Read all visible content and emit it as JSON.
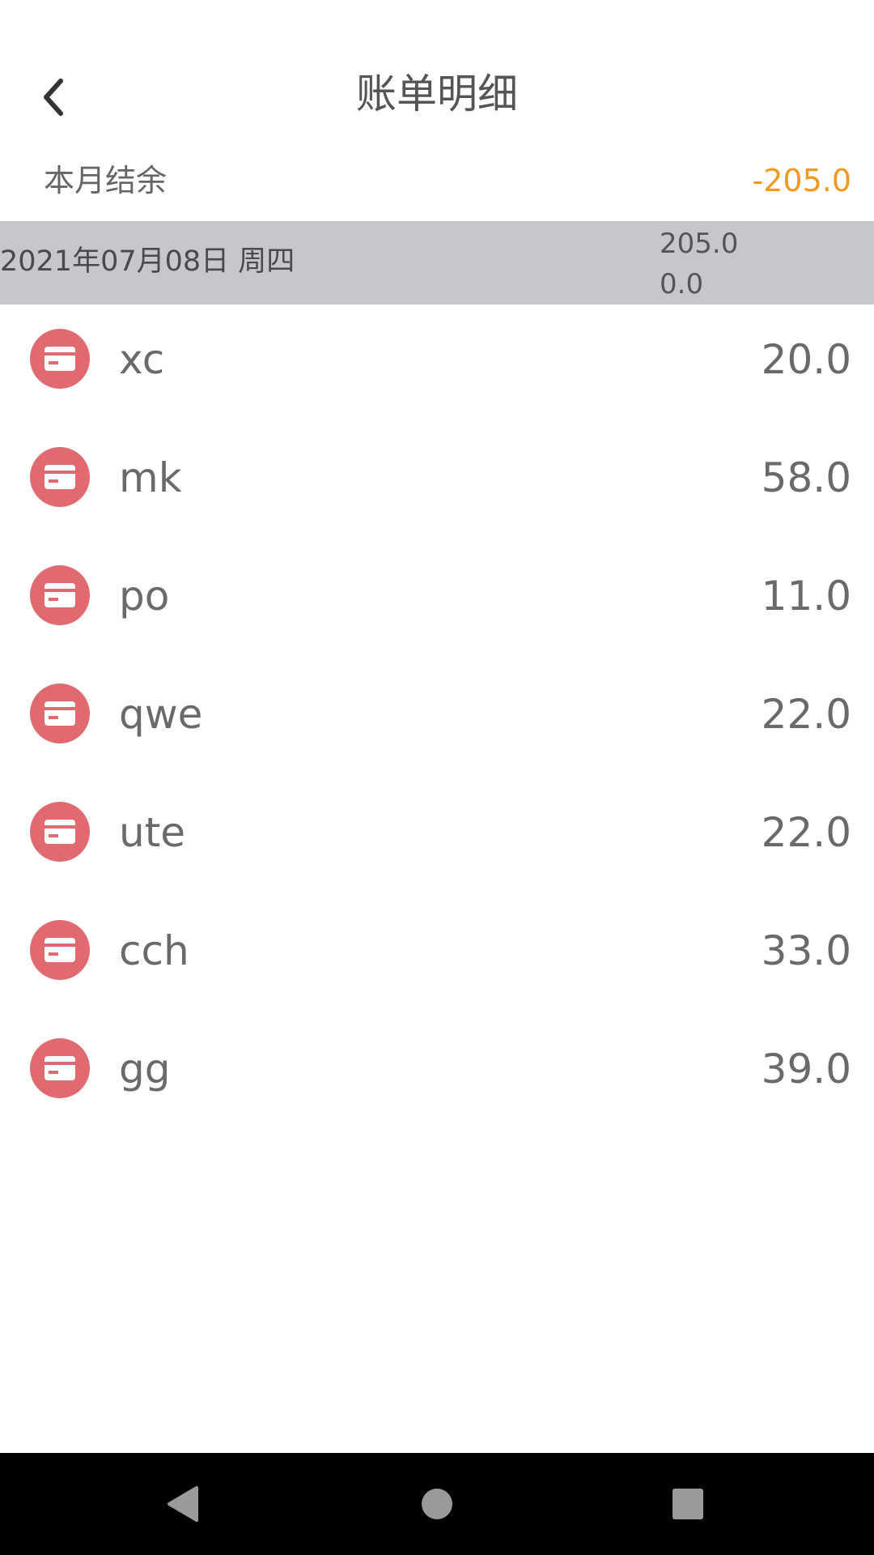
{
  "header": {
    "title": "账单明细",
    "back_icon": "chevron-left-icon"
  },
  "summary": {
    "label": "本月结余",
    "value": "-205.0",
    "value_color": "#f29a1d"
  },
  "day_group": {
    "date": "2021年07月08日 周四",
    "expense_total": "205.0",
    "income_total": "0.0"
  },
  "bills": [
    {
      "name": "xc",
      "amount": "20.0",
      "icon": "card-icon"
    },
    {
      "name": "mk",
      "amount": "58.0",
      "icon": "card-icon"
    },
    {
      "name": "po",
      "amount": "11.0",
      "icon": "card-icon"
    },
    {
      "name": "qwe",
      "amount": "22.0",
      "icon": "card-icon"
    },
    {
      "name": "ute",
      "amount": "22.0",
      "icon": "card-icon"
    },
    {
      "name": "cch",
      "amount": "33.0",
      "icon": "card-icon"
    },
    {
      "name": "gg",
      "amount": "39.0",
      "icon": "card-icon"
    }
  ],
  "colors": {
    "icon_background": "#e06a70",
    "date_bar_background": "#c6c6cc"
  },
  "nav": {
    "back_icon": "triangle-back-icon",
    "home_icon": "circle-home-icon",
    "recents_icon": "square-recents-icon"
  }
}
